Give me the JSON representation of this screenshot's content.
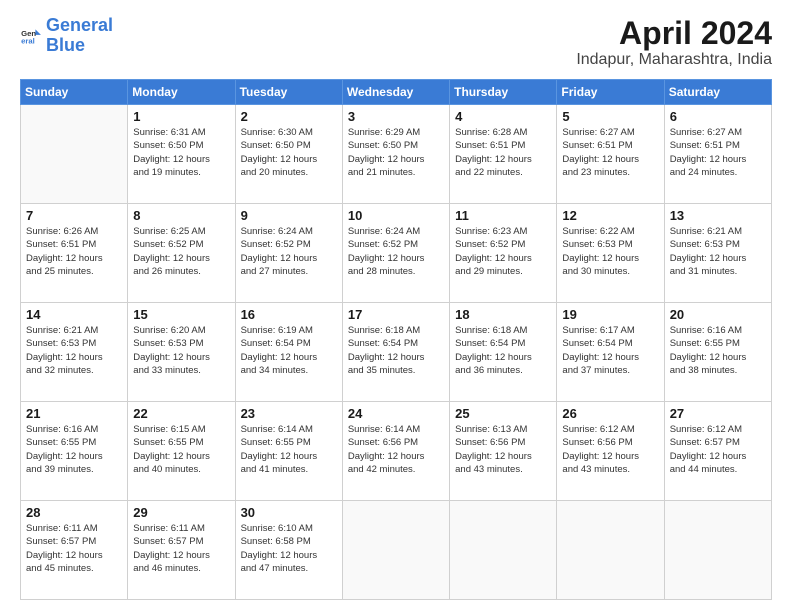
{
  "logo": {
    "line1": "General",
    "line2": "Blue"
  },
  "title": "April 2024",
  "subtitle": "Indapur, Maharashtra, India",
  "weekdays": [
    "Sunday",
    "Monday",
    "Tuesday",
    "Wednesday",
    "Thursday",
    "Friday",
    "Saturday"
  ],
  "weeks": [
    [
      {
        "date": "",
        "info": ""
      },
      {
        "date": "1",
        "info": "Sunrise: 6:31 AM\nSunset: 6:50 PM\nDaylight: 12 hours\nand 19 minutes."
      },
      {
        "date": "2",
        "info": "Sunrise: 6:30 AM\nSunset: 6:50 PM\nDaylight: 12 hours\nand 20 minutes."
      },
      {
        "date": "3",
        "info": "Sunrise: 6:29 AM\nSunset: 6:50 PM\nDaylight: 12 hours\nand 21 minutes."
      },
      {
        "date": "4",
        "info": "Sunrise: 6:28 AM\nSunset: 6:51 PM\nDaylight: 12 hours\nand 22 minutes."
      },
      {
        "date": "5",
        "info": "Sunrise: 6:27 AM\nSunset: 6:51 PM\nDaylight: 12 hours\nand 23 minutes."
      },
      {
        "date": "6",
        "info": "Sunrise: 6:27 AM\nSunset: 6:51 PM\nDaylight: 12 hours\nand 24 minutes."
      }
    ],
    [
      {
        "date": "7",
        "info": "Sunrise: 6:26 AM\nSunset: 6:51 PM\nDaylight: 12 hours\nand 25 minutes."
      },
      {
        "date": "8",
        "info": "Sunrise: 6:25 AM\nSunset: 6:52 PM\nDaylight: 12 hours\nand 26 minutes."
      },
      {
        "date": "9",
        "info": "Sunrise: 6:24 AM\nSunset: 6:52 PM\nDaylight: 12 hours\nand 27 minutes."
      },
      {
        "date": "10",
        "info": "Sunrise: 6:24 AM\nSunset: 6:52 PM\nDaylight: 12 hours\nand 28 minutes."
      },
      {
        "date": "11",
        "info": "Sunrise: 6:23 AM\nSunset: 6:52 PM\nDaylight: 12 hours\nand 29 minutes."
      },
      {
        "date": "12",
        "info": "Sunrise: 6:22 AM\nSunset: 6:53 PM\nDaylight: 12 hours\nand 30 minutes."
      },
      {
        "date": "13",
        "info": "Sunrise: 6:21 AM\nSunset: 6:53 PM\nDaylight: 12 hours\nand 31 minutes."
      }
    ],
    [
      {
        "date": "14",
        "info": "Sunrise: 6:21 AM\nSunset: 6:53 PM\nDaylight: 12 hours\nand 32 minutes."
      },
      {
        "date": "15",
        "info": "Sunrise: 6:20 AM\nSunset: 6:53 PM\nDaylight: 12 hours\nand 33 minutes."
      },
      {
        "date": "16",
        "info": "Sunrise: 6:19 AM\nSunset: 6:54 PM\nDaylight: 12 hours\nand 34 minutes."
      },
      {
        "date": "17",
        "info": "Sunrise: 6:18 AM\nSunset: 6:54 PM\nDaylight: 12 hours\nand 35 minutes."
      },
      {
        "date": "18",
        "info": "Sunrise: 6:18 AM\nSunset: 6:54 PM\nDaylight: 12 hours\nand 36 minutes."
      },
      {
        "date": "19",
        "info": "Sunrise: 6:17 AM\nSunset: 6:54 PM\nDaylight: 12 hours\nand 37 minutes."
      },
      {
        "date": "20",
        "info": "Sunrise: 6:16 AM\nSunset: 6:55 PM\nDaylight: 12 hours\nand 38 minutes."
      }
    ],
    [
      {
        "date": "21",
        "info": "Sunrise: 6:16 AM\nSunset: 6:55 PM\nDaylight: 12 hours\nand 39 minutes."
      },
      {
        "date": "22",
        "info": "Sunrise: 6:15 AM\nSunset: 6:55 PM\nDaylight: 12 hours\nand 40 minutes."
      },
      {
        "date": "23",
        "info": "Sunrise: 6:14 AM\nSunset: 6:55 PM\nDaylight: 12 hours\nand 41 minutes."
      },
      {
        "date": "24",
        "info": "Sunrise: 6:14 AM\nSunset: 6:56 PM\nDaylight: 12 hours\nand 42 minutes."
      },
      {
        "date": "25",
        "info": "Sunrise: 6:13 AM\nSunset: 6:56 PM\nDaylight: 12 hours\nand 43 minutes."
      },
      {
        "date": "26",
        "info": "Sunrise: 6:12 AM\nSunset: 6:56 PM\nDaylight: 12 hours\nand 43 minutes."
      },
      {
        "date": "27",
        "info": "Sunrise: 6:12 AM\nSunset: 6:57 PM\nDaylight: 12 hours\nand 44 minutes."
      }
    ],
    [
      {
        "date": "28",
        "info": "Sunrise: 6:11 AM\nSunset: 6:57 PM\nDaylight: 12 hours\nand 45 minutes."
      },
      {
        "date": "29",
        "info": "Sunrise: 6:11 AM\nSunset: 6:57 PM\nDaylight: 12 hours\nand 46 minutes."
      },
      {
        "date": "30",
        "info": "Sunrise: 6:10 AM\nSunset: 6:58 PM\nDaylight: 12 hours\nand 47 minutes."
      },
      {
        "date": "",
        "info": ""
      },
      {
        "date": "",
        "info": ""
      },
      {
        "date": "",
        "info": ""
      },
      {
        "date": "",
        "info": ""
      }
    ]
  ]
}
